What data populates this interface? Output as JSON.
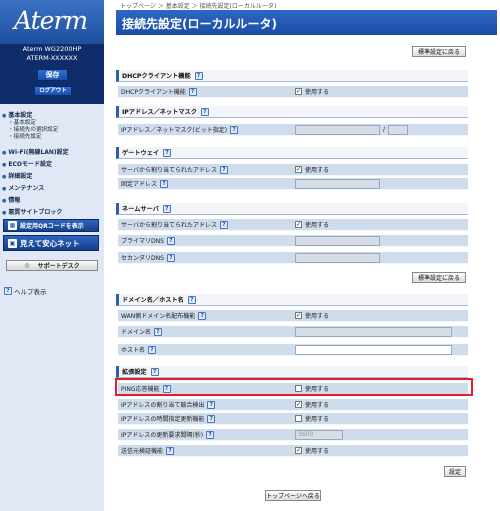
{
  "brand": {
    "logo": "Aterm",
    "device_name": "Aterm WG2200HP",
    "device_id": "ATERM-XXXXXX"
  },
  "left": {
    "save_label": "保存",
    "logout_label": "ログアウト",
    "nav": [
      {
        "label": "基本設定",
        "children": [
          "基本設定",
          "接続先の選択設定",
          "接続先設定"
        ]
      },
      {
        "label": "Wi-Fi(無線LAN)設定",
        "children": []
      },
      {
        "label": "ECOモード設定",
        "children": []
      },
      {
        "label": "詳細設定",
        "children": []
      },
      {
        "label": "メンテナンス",
        "children": []
      },
      {
        "label": "情報",
        "children": []
      },
      {
        "label": "悪質サイトブロック",
        "children": []
      }
    ],
    "qr_button": "設定用QRコードを表示",
    "mieru_button": "見えて安心ネット",
    "support_button": "サポートデスク",
    "help_label": "ヘルプ表示"
  },
  "breadcrumb": "トップページ ＞ 基本設定 ＞ 接続先設定(ローカルルータ)",
  "title": "接続先設定(ローカルルータ)",
  "reset_label": "標準設定に戻る",
  "sections": {
    "dhcp": {
      "title": "DHCPクライアント機能",
      "row_label": "DHCPクライアント機能",
      "check_label": "使用する"
    },
    "ipmask": {
      "title": "IPアドレス／ネットマスク",
      "row_label": "IPアドレス／ネットマスク(ビット指定)",
      "sep": "/"
    },
    "gateway": {
      "title": "ゲートウェイ",
      "auto_label": "サーバから割り当てられたアドレス",
      "auto_check": "使用する",
      "fixed_label": "固定アドレス"
    },
    "dns": {
      "title": "ネームサーバ",
      "auto_label": "サーバから割り当てられたアドレス",
      "auto_check": "使用する",
      "primary_label": "プライマリDNS",
      "secondary_label": "セカンダリDNS"
    },
    "domain": {
      "title": "ドメイン名／ホスト名",
      "wan_label": "WAN側ドメイン名配布機能",
      "wan_check": "使用する",
      "domain_label": "ドメイン名",
      "host_label": "ホスト名"
    },
    "ext": {
      "title": "拡張設定",
      "rows": [
        {
          "label": "PING応答機能",
          "check": "使用する",
          "checked": false
        },
        {
          "label": "IPアドレスの割り当て競合検出",
          "check": "使用する",
          "checked": true
        },
        {
          "label": "IPアドレスの時間指定更新機能",
          "check": "使用する",
          "checked": false
        },
        {
          "label": "IPアドレスの更新要求間隔(秒)",
          "value": "3600"
        },
        {
          "label": "送信元検証機能",
          "check": "使用する",
          "checked": true
        }
      ]
    }
  },
  "set_label": "設定",
  "top_label": "トップページへ戻る",
  "check_mark": "✓",
  "colors": {
    "accent": "#1a4da4",
    "row_bg": "#cfdceb",
    "highlight": "#e0202a"
  }
}
